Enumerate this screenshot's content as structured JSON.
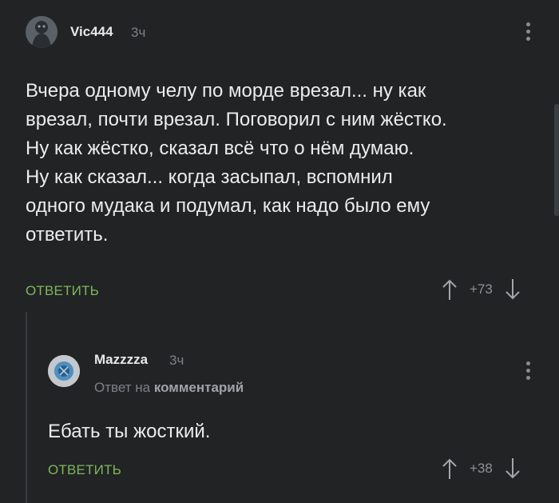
{
  "comments": [
    {
      "username": "Vic444",
      "time": "3ч",
      "text_lines": [
        "Вчера одному челу по морде врезал... ну как",
        "врезал, почти врезал. Поговорил с ним жёстко.",
        "Ну как жёстко, сказал всё что о нём думаю.",
        "Ну как сказал... когда засыпал, вспомнил",
        "одного мудака и подумал, как надо было ему",
        "ответить."
      ],
      "reply_label": "ОТВЕТИТЬ",
      "rating": "+73"
    },
    {
      "username": "Mazzzza",
      "time": "3ч",
      "reply_to_prefix": "Ответ на",
      "reply_to_target": "комментарий",
      "text": "Ебать ты жосткий.",
      "reply_label": "ОТВЕТИТЬ",
      "rating": "+38"
    }
  ],
  "colors": {
    "background": "#212325",
    "accent_green": "#7fb65a",
    "muted_text": "#7d8185"
  },
  "icons": [
    "avatar-vic444",
    "avatar-mazzzza",
    "more-vertical-icon",
    "arrow-up-icon",
    "arrow-down-icon"
  ]
}
